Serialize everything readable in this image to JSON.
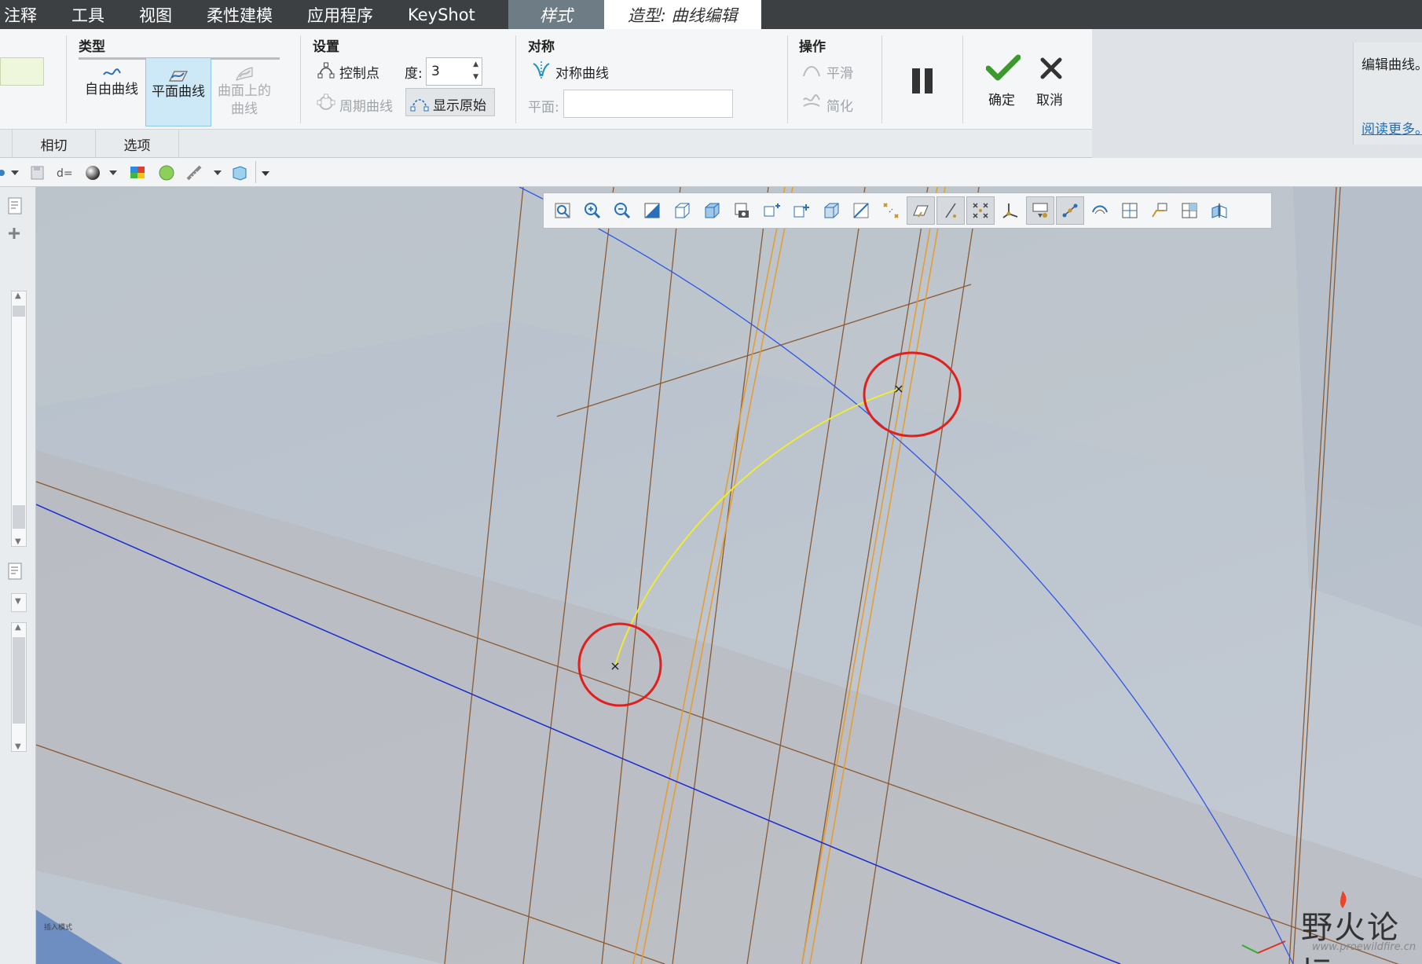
{
  "menubar": {
    "items": [
      "注释",
      "工具",
      "视图",
      "柔性建模",
      "应用程序",
      "KeyShot"
    ],
    "style_tab": "样式",
    "active_tab": "造型: 曲线编辑"
  },
  "ribbon": {
    "type_group": {
      "title": "类型",
      "free_curve": "自由曲线",
      "planar_curve": "平面曲线",
      "curve_on_surface_line1": "曲面上的",
      "curve_on_surface_line2": "曲线"
    },
    "settings_group": {
      "title": "设置",
      "control_points": "控制点",
      "degree_label": "度:",
      "degree_value": "3",
      "periodic_curve": "周期曲线",
      "show_original": "显示原始"
    },
    "symmetry_group": {
      "title": "对称",
      "symmetric_curve": "对称曲线",
      "plane_label": "平面:"
    },
    "operations_group": {
      "title": "操作",
      "smooth": "平滑",
      "simplify": "简化"
    },
    "ok_label": "确定",
    "cancel_label": "取消",
    "tabs": [
      "相切",
      "选项"
    ]
  },
  "help_panel": {
    "text": "编辑曲线。",
    "link": "阅读更多。"
  },
  "viewport": {
    "status_text": "插入模式"
  },
  "watermark": {
    "text": "野火论坛",
    "url": "www.proewildfire.cn"
  },
  "colors": {
    "menubar": "#3c4043",
    "selected_button": "#cde8f6",
    "highlight_circle": "#e0201c",
    "edited_curve": "#f2ee2a",
    "blue_curve": "#1a2bd0"
  },
  "icons": {
    "pause": "pause-icon",
    "ok": "checkmark-icon",
    "cancel": "close-icon"
  }
}
